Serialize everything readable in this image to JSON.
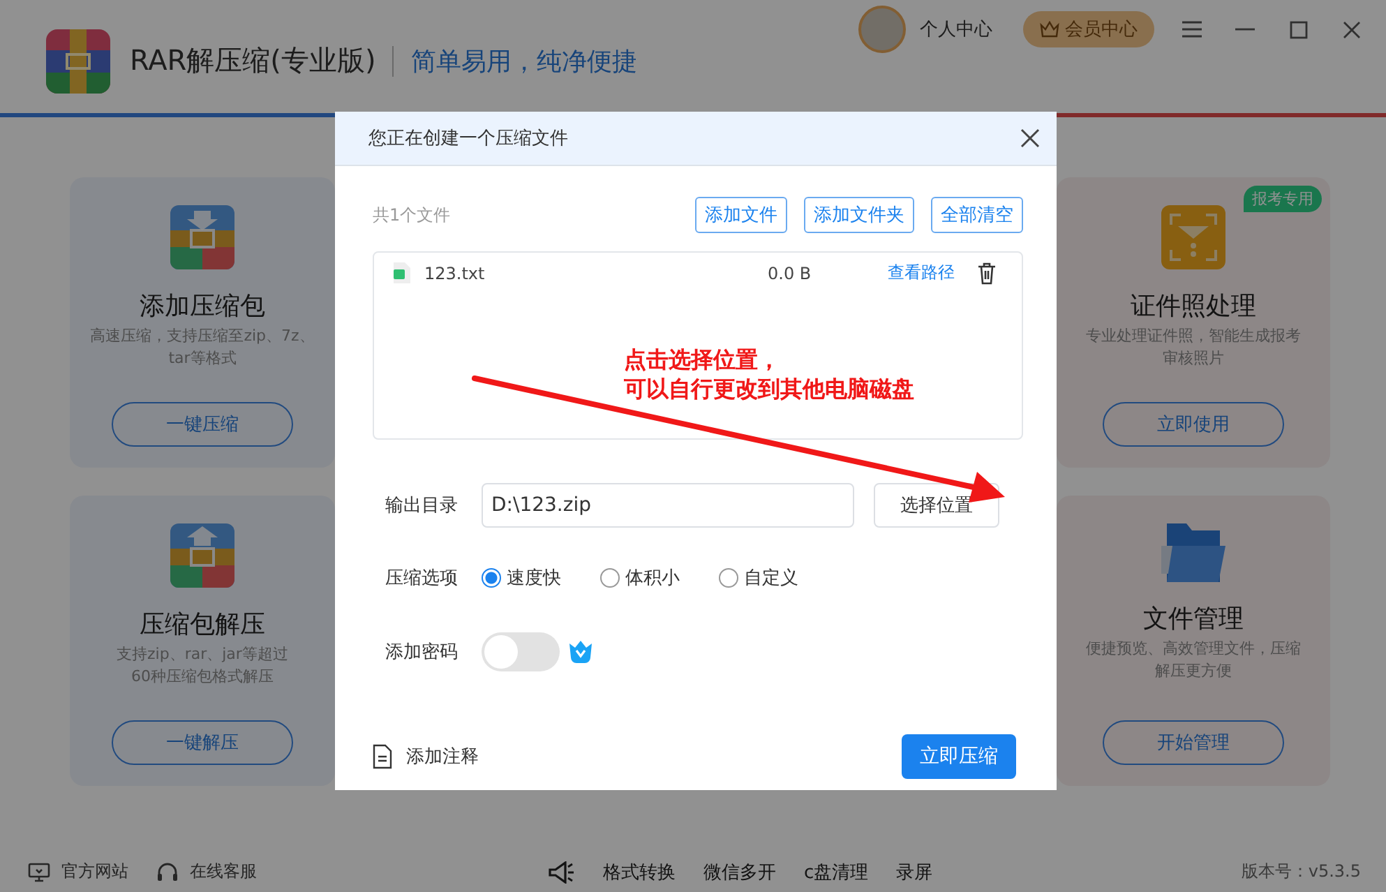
{
  "app": {
    "title": "RAR解压缩(专业版)",
    "slogan": "简单易用，纯净便捷",
    "user_label": "个人中心",
    "vip_button": "会员中心"
  },
  "left_cards": [
    {
      "kind": "compress",
      "title": "添加压缩包",
      "description": [
        "高速压缩，支持压缩至zip、7z、",
        "tar等格式"
      ],
      "button": "一键压缩"
    },
    {
      "kind": "extract",
      "title": "压缩包解压",
      "description": [
        "支持zip、rar、jar等超过",
        "60种压缩包格式解压"
      ],
      "button": "一键解压"
    }
  ],
  "right_cards": [
    {
      "kind": "id_photo",
      "title": "证件照处理",
      "description": [
        "专业处理证件照，智能生成报考",
        "审核照片"
      ],
      "button": "立即使用",
      "badge": "报考专用"
    },
    {
      "kind": "folder",
      "title": "文件管理",
      "description": [
        "便捷预览、高效管理文件，压缩",
        "解压更方便"
      ],
      "button": "开始管理"
    }
  ],
  "footer": {
    "links": [
      {
        "kind": "monitor",
        "label": "官方网站"
      },
      {
        "kind": "headset",
        "label": "在线客服"
      }
    ],
    "tools": [
      "格式转换",
      "微信多开",
      "c盘清理",
      "录屏"
    ],
    "version": "版本号：v5.3.5"
  },
  "dialog": {
    "title": "您正在创建一个压缩文件",
    "file_count": "共1个文件",
    "actions": [
      "添加文件",
      "添加文件夹",
      "全部清空"
    ],
    "files": [
      {
        "name": "123.txt",
        "size": "0.0 B",
        "link": "查看路径"
      }
    ],
    "annotation": [
      "点击选择位置，",
      "可以自行更改到其他电脑磁盘"
    ],
    "output_label": "输出目录",
    "output_value": "D:\\123.zip",
    "choose_button": "选择位置",
    "options_label": "压缩选项",
    "options": [
      {
        "label": "速度快",
        "selected": true
      },
      {
        "label": "体积小",
        "selected": false
      },
      {
        "label": "自定义",
        "selected": false
      }
    ],
    "password_label": "添加密码",
    "password_on": false,
    "note_label": "添加注释",
    "submit": "立即压缩"
  }
}
